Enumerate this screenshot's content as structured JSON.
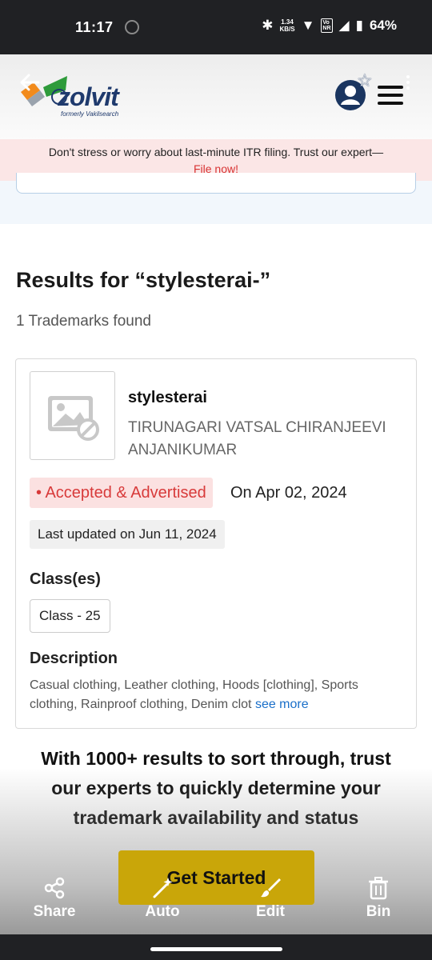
{
  "status_bar": {
    "time": "11:17",
    "speed": "1.34",
    "speed_unit": "KB/S",
    "volte_top": "Vo",
    "volte_bottom": "NR",
    "battery": "64%"
  },
  "header": {
    "logo_text": "zolvit",
    "logo_subtitle": "formerly Vakilsearch"
  },
  "banner": {
    "text": "Don't stress or worry about last-minute ITR filing. Trust our expert—",
    "link": "File now!"
  },
  "results": {
    "title": "Results for “stylesterai-”",
    "count_text": "1 Trademarks found"
  },
  "trademark": {
    "name": "stylesterai",
    "owner": "TIRUNAGARI VATSAL CHIRANJEEVI ANJANIKUMAR",
    "status": "• Accepted & Advertised",
    "status_date": "On Apr 02, 2024",
    "last_updated": "Last updated on Jun 11, 2024",
    "classes_heading": "Class(es)",
    "class_label": "Class - 25",
    "description_heading": "Description",
    "description": "Casual clothing, Leather clothing, Hoods [clothing], Sports clothing, Rainproof clothing, Denim clot",
    "see_more": "see more"
  },
  "cta": {
    "text": "With 1000+ results to sort through, trust our experts to quickly determine your trademark availability and status",
    "button": "Get Started"
  },
  "toolbar": {
    "share": "Share",
    "auto": "Auto",
    "edit": "Edit",
    "bin": "Bin"
  },
  "colors": {
    "accent_red": "#d83a3a",
    "button_gold": "#c9a609",
    "brand_navy": "#1a3560"
  }
}
